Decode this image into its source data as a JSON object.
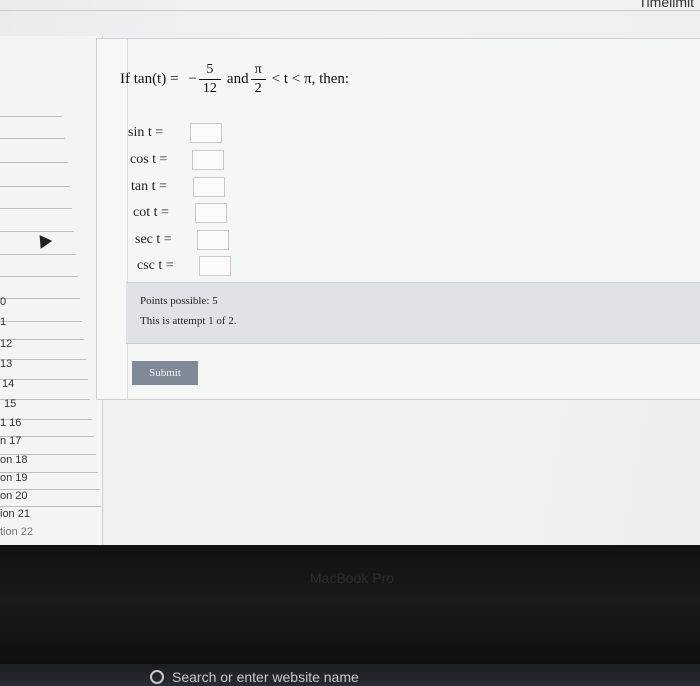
{
  "header": {
    "partial_title": "Timelimit"
  },
  "sidebar": {
    "items": [
      "0",
      "1",
      "12",
      "13",
      "14",
      "15",
      "1 16",
      "n 17",
      "on 18",
      "on 19",
      "on 20",
      "ion 21",
      "tion 22"
    ]
  },
  "question": {
    "prefix": "If tan(t) =",
    "minus": "−",
    "num1": "5",
    "den1": "12",
    "and": "and",
    "num2": "π",
    "den2": "2",
    "suffix": "< t < π, then:"
  },
  "answers": [
    {
      "label": "sin t =",
      "value": ""
    },
    {
      "label": "cos t =",
      "value": ""
    },
    {
      "label": "tan t =",
      "value": ""
    },
    {
      "label": "cot t =",
      "value": ""
    },
    {
      "label": "sec t =",
      "value": ""
    },
    {
      "label": "csc t =",
      "value": ""
    }
  ],
  "info": {
    "points": "Points possible: 5",
    "attempt": "This is attempt 1 of 2."
  },
  "submit_label": "Submit",
  "bezel": {
    "brand": "MacBook Pro",
    "search_placeholder": "Search or enter website name"
  },
  "colors": {
    "submit_bg": "#7e8a96",
    "info_bg": "#dfe3e7"
  }
}
